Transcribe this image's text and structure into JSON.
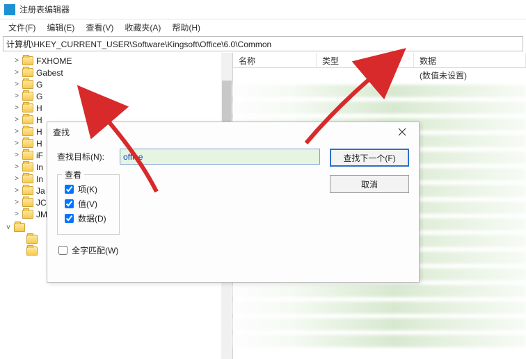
{
  "window": {
    "title": "注册表编辑器"
  },
  "menu": {
    "file": "文件(F)",
    "edit": "编辑(E)",
    "view": "查看(V)",
    "favorites": "收藏夹(A)",
    "help": "帮助(H)"
  },
  "path": "计算机\\HKEY_CURRENT_USER\\Software\\Kingsoft\\Office\\6.0\\Common",
  "tree": {
    "items": [
      {
        "label": "FXHOME",
        "expander": ">"
      },
      {
        "label": "Gabest",
        "expander": ">"
      },
      {
        "label": "G",
        "expander": ">"
      },
      {
        "label": "G",
        "expander": ">"
      },
      {
        "label": "H",
        "expander": ">"
      },
      {
        "label": "H",
        "expander": ">"
      },
      {
        "label": "H",
        "expander": ">"
      },
      {
        "label": "H",
        "expander": ">"
      },
      {
        "label": "iF",
        "expander": ">"
      },
      {
        "label": "In",
        "expander": ">"
      },
      {
        "label": "In",
        "expander": ">"
      },
      {
        "label": "Ja",
        "expander": ">"
      },
      {
        "label": "JC",
        "expander": ">"
      },
      {
        "label": "JMSDK",
        "expander": ">"
      }
    ],
    "selected_expander": "v"
  },
  "list": {
    "headers": {
      "name": "名称",
      "type": "类型",
      "data": "数据"
    },
    "default_row": {
      "name": "",
      "type": "",
      "data": "(数值未设置)"
    }
  },
  "dialog": {
    "title": "查找",
    "label_target": "查找目标(N):",
    "input_value": "office",
    "group_title": "查看",
    "chk_keys": "项(K)",
    "chk_values": "值(V)",
    "chk_data": "数据(D)",
    "full_match": "全字匹配(W)",
    "btn_find": "查找下一个(F)",
    "btn_cancel": "取消"
  }
}
